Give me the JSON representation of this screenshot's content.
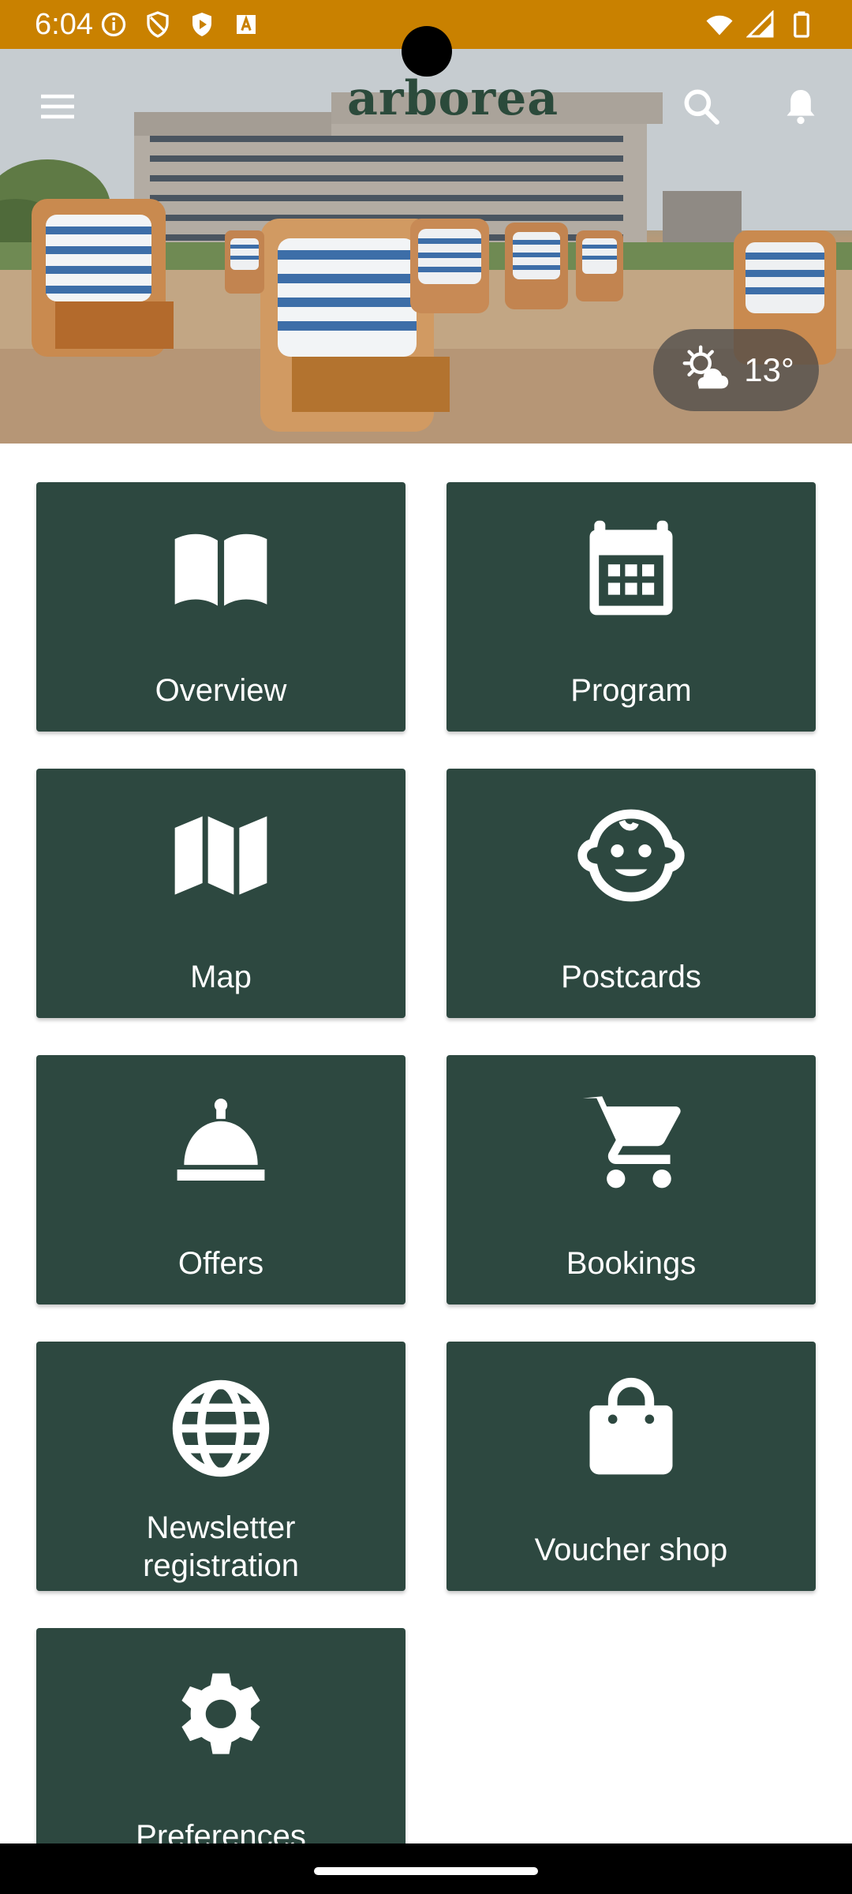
{
  "status_bar": {
    "time": "6:04",
    "background": "#c98100",
    "left_icons": [
      "info-icon",
      "shield-icon",
      "play-shield-icon",
      "a-box-icon"
    ],
    "right_icons": [
      "wifi-icon",
      "signal-icon",
      "battery-icon"
    ]
  },
  "header": {
    "brand": "arborea",
    "menu_icon": "hamburger-menu-icon",
    "search_icon": "search-icon",
    "notification_icon": "bell-icon"
  },
  "weather": {
    "icon": "partly-sunny-icon",
    "temperature": "13°"
  },
  "tiles": [
    {
      "label": "Overview",
      "icon": "open-book-icon"
    },
    {
      "label": "Program",
      "icon": "calendar-icon"
    },
    {
      "label": "Map",
      "icon": "map-icon"
    },
    {
      "label": "Postcards",
      "icon": "face-icon"
    },
    {
      "label": "Offers",
      "icon": "service-bell-icon"
    },
    {
      "label": "Bookings",
      "icon": "shopping-cart-icon"
    },
    {
      "label": "Newsletter\nregistration",
      "icon": "globe-icon"
    },
    {
      "label": "Voucher shop",
      "icon": "shopping-bag-icon"
    },
    {
      "label": "Preferences",
      "icon": "gear-icon"
    }
  ],
  "colors": {
    "tile_background": "#2d4840",
    "tile_text": "#ffffff",
    "status_bar": "#c98100"
  }
}
